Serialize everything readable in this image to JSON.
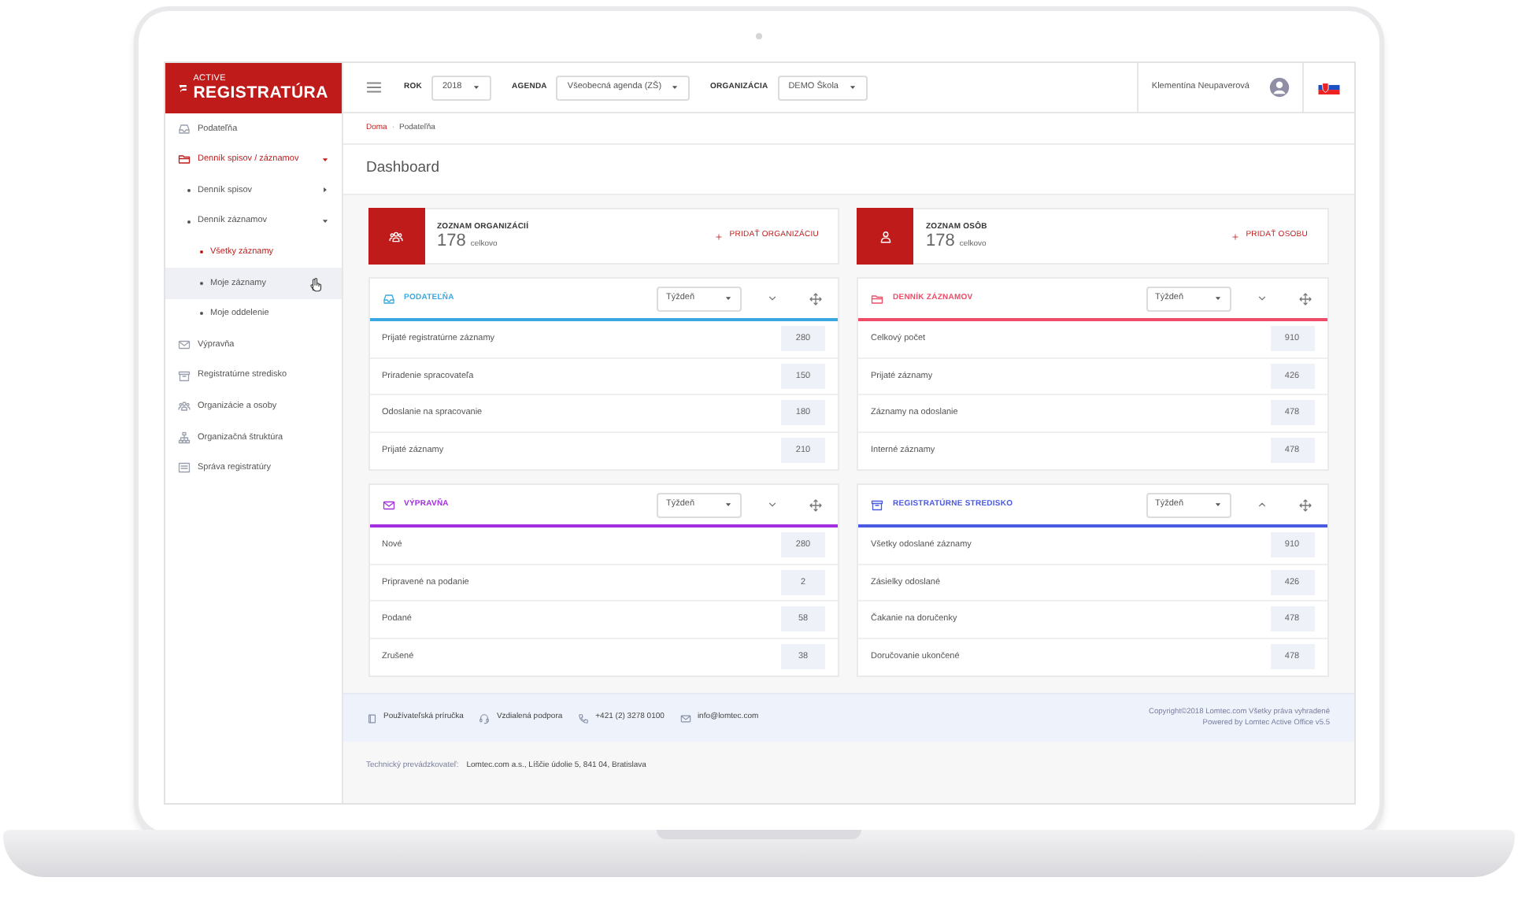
{
  "brand": {
    "line1": "ACTIVE",
    "line2": "REGISTRATÚRA"
  },
  "topbar": {
    "filters": [
      {
        "label": "ROK",
        "value": "2018"
      },
      {
        "label": "AGENDA",
        "value": "Všeobecná agenda (ZŠ)"
      },
      {
        "label": "ORGANIZÁCIA",
        "value": "DEMO Škola"
      }
    ],
    "user": "Klementína Neupaverová"
  },
  "sidebar": {
    "items": [
      {
        "kind": "inbox",
        "label": "Podateľňa",
        "selected": false,
        "hovered": false
      },
      {
        "kind": "folder",
        "label": "Denník spisov / záznamov",
        "selected": true,
        "hovered": false,
        "expanded": true,
        "children": [
          {
            "label": "Denník spisov",
            "selected": false,
            "hovered": false,
            "expanded": false
          },
          {
            "label": "Denník záznamov",
            "selected": false,
            "hovered": false,
            "expanded": true,
            "children": [
              {
                "label": "Všetky záznamy",
                "selected": true,
                "hovered": false
              },
              {
                "label": "Moje záznamy",
                "selected": false,
                "hovered": true
              },
              {
                "label": "Moje oddelenie",
                "selected": false,
                "hovered": false
              }
            ]
          }
        ]
      },
      {
        "kind": "envelope",
        "label": "Výpravňa",
        "selected": false,
        "hovered": false
      },
      {
        "kind": "archive",
        "label": "Registratúrne stredisko",
        "selected": false,
        "hovered": false
      },
      {
        "kind": "people",
        "label": "Organizácie a osoby",
        "selected": false,
        "hovered": false
      },
      {
        "kind": "hierarchy",
        "label": "Organizačná štruktúra",
        "selected": false,
        "hovered": false
      },
      {
        "kind": "register",
        "label": "Správa registratúry",
        "selected": false,
        "hovered": false
      }
    ]
  },
  "breadcrumb": [
    "Doma",
    "Podateľňa"
  ],
  "breadcrumb_separator": "·",
  "page_title": "Dashboard",
  "columns": [
    {
      "summary": {
        "kind": "people",
        "title": "ZOZNAM ORGANIZÁCIÍ",
        "count": "178",
        "unit": "celkovo",
        "action": "PRIDAŤ ORGANIZÁCIU"
      },
      "widgets": [
        {
          "kind": "inbox",
          "title": "PODATEĽŇA",
          "color": "#3aa8e0",
          "period": "Týždeň",
          "expanded": false,
          "rows": [
            {
              "label": "Prijaté registratúrne záznamy",
              "value": "280"
            },
            {
              "label": "Priradenie spracovateľa",
              "value": "150"
            },
            {
              "label": "Odoslanie na spracovanie",
              "value": "180"
            },
            {
              "label": "Prijaté záznamy",
              "value": "210"
            }
          ]
        },
        {
          "kind": "envelope",
          "title": "VÝPRAVŇA",
          "color": "#a32ee0",
          "period": "Týždeň",
          "expanded": false,
          "rows": [
            {
              "label": "Nové",
              "value": "280"
            },
            {
              "label": "Pripravené na podanie",
              "value": "2"
            },
            {
              "label": "Podané",
              "value": "58"
            },
            {
              "label": "Zrušené",
              "value": "38"
            }
          ]
        }
      ]
    },
    {
      "summary": {
        "kind": "person",
        "title": "ZOZNAM OSÔB",
        "count": "178",
        "unit": "celkovo",
        "action": "PRIDAŤ OSOBU"
      },
      "widgets": [
        {
          "kind": "folder",
          "title": "DENNÍK ZÁZNAMOV",
          "color": "#ee4c68",
          "period": "Týždeň",
          "expanded": false,
          "rows": [
            {
              "label": "Celkový počet",
              "value": "910"
            },
            {
              "label": "Prijaté záznamy",
              "value": "426"
            },
            {
              "label": "Záznamy na odoslanie",
              "value": "478"
            },
            {
              "label": "Interné záznamy",
              "value": "478"
            }
          ]
        },
        {
          "kind": "archive",
          "title": "REGISTRATÚRNE STREDISKO",
          "color": "#4a5ae0",
          "period": "Týždeň",
          "expanded": true,
          "rows": [
            {
              "label": "Všetky odoslané záznamy",
              "value": "910"
            },
            {
              "label": "Zásielky odoslané",
              "value": "426"
            },
            {
              "label": "Čakanie na doručenky",
              "value": "478"
            },
            {
              "label": "Doručovanie ukončené",
              "value": "478"
            }
          ]
        }
      ]
    }
  ],
  "footer": {
    "links": [
      {
        "kind": "book",
        "text": "Používateľská príručka"
      },
      {
        "kind": "headset",
        "text": "Vzdialená podpora"
      },
      {
        "kind": "phone",
        "text": "+421 (2) 3278 0100"
      },
      {
        "kind": "envelope",
        "text": "info@lomtec.com"
      }
    ],
    "copyright": [
      "Copyright©2018 Lomtec.com Všetky práva vyhradené",
      "Powered by Lomtec Active Office v5.5"
    ],
    "provider_label": "Technický prevádzkovateľ:",
    "provider": "Lomtec.com a.s., Líščie údolie 5, 841 04, Bratislava"
  }
}
